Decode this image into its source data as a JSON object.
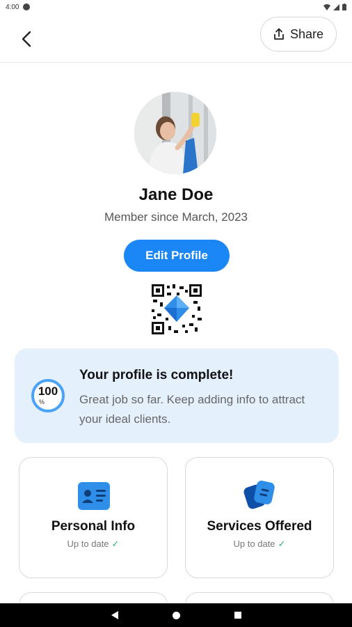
{
  "status_bar": {
    "time": "4:00",
    "icons": [
      "circle-status-icon",
      "wifi-icon",
      "signal-icon",
      "battery-icon"
    ]
  },
  "app_bar": {
    "back_icon": "chevron-left-icon",
    "share_label": "Share",
    "share_icon": "share-upload-icon"
  },
  "profile": {
    "name": "Jane Doe",
    "member_since": "Member since March, 2023",
    "edit_label": "Edit Profile",
    "qr_icon": "qr-code-icon"
  },
  "completion": {
    "progress_value": "100",
    "progress_unit": "%",
    "title": "Your profile is complete!",
    "description": "Great job so far. Keep adding info to attract your ideal clients."
  },
  "tiles": [
    {
      "title": "Personal Info",
      "status": "Up to date",
      "icon": "id-card-icon"
    },
    {
      "title": "Services Offered",
      "status": "Up to date",
      "icon": "documents-icon"
    }
  ],
  "colors": {
    "accent": "#1b86f5",
    "card_bg": "#e5f0fd",
    "check": "#2bb673"
  }
}
